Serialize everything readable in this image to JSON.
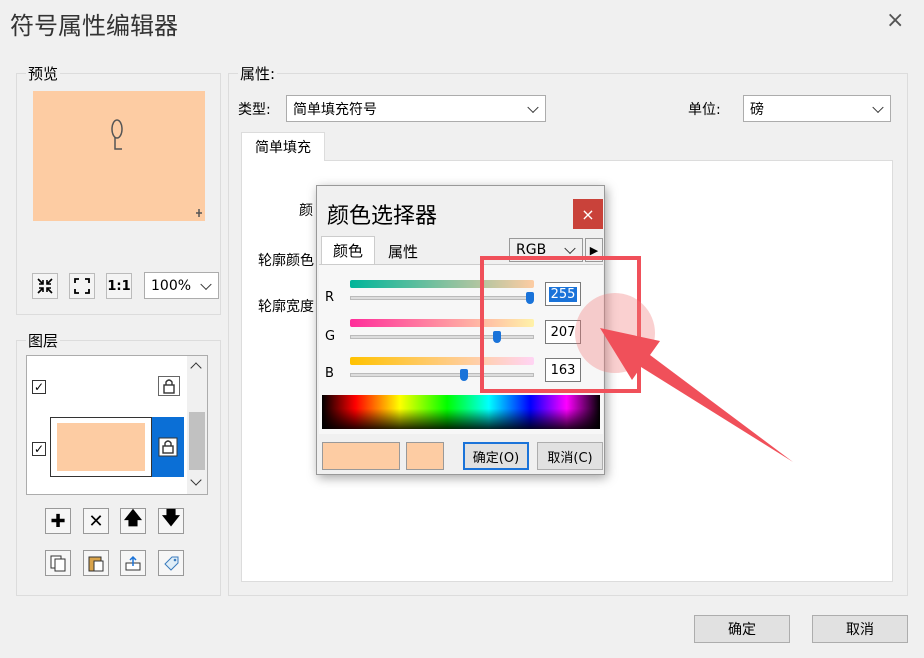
{
  "window": {
    "title": "符号属性编辑器",
    "close_glyph": "×"
  },
  "preview_group": {
    "label": "预览",
    "zoom_value": "100%",
    "preview_color": "#fdcca3"
  },
  "preview_tools": {
    "fit_label": "↘↙",
    "full_label": "⛶",
    "actual_label": "1:1"
  },
  "layers_group": {
    "label": "图层"
  },
  "properties": {
    "label": "属性:",
    "type_label": "类型:",
    "type_value": "简单填充符号",
    "unit_label": "单位:",
    "unit_value": "磅",
    "tab_label": "简单填充",
    "color_label_partial": "颜",
    "outline_color_label": "轮廓颜色",
    "outline_width_label": "轮廓宽度"
  },
  "color_picker": {
    "title": "颜色选择器",
    "close_glyph": "×",
    "tab_color": "颜色",
    "tab_props": "属性",
    "model_value": "RGB",
    "r_label": "R",
    "g_label": "G",
    "b_label": "B",
    "r_value": "255",
    "g_value": "207",
    "b_value": "163",
    "ok_label": "确定(O)",
    "cancel_label": "取消(C)",
    "current_color": "#fdcca3"
  },
  "footer": {
    "ok_label": "确定",
    "cancel_label": "取消"
  },
  "highlight_color": "#f0505a"
}
